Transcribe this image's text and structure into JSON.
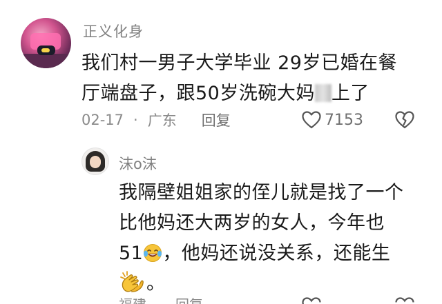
{
  "comment": {
    "username": "正义化身",
    "text_line1": "我们村一男子大学毕业 29岁已婚在餐",
    "text_line2a": "厅端盘子，跟50岁洗碗大妈",
    "text_line2b": "上了",
    "date": "02-17",
    "separator": "·",
    "location": "广东",
    "reply_label": "回复",
    "like_count": "7153"
  },
  "reply": {
    "username": "沫o沫",
    "line1": "我隔壁姐姐家的侄儿就是找了一个",
    "line2": "比他妈还大两岁的女人，今年也",
    "line3a": "51",
    "line3b": "，他妈还说没关系，还能生",
    "line4": "。",
    "partial_location": "福建",
    "partial_reply_label": "回复"
  },
  "icons": {
    "like": "heart-outline-icon",
    "dislike": "broken-heart-icon",
    "emoji1": "laughing-tears-emoji",
    "emoji2": "clapping-hands-emoji"
  },
  "colors": {
    "text_primary": "#1a1a1a",
    "text_secondary": "#808080",
    "emoji_yellow": "#f7c53a"
  }
}
